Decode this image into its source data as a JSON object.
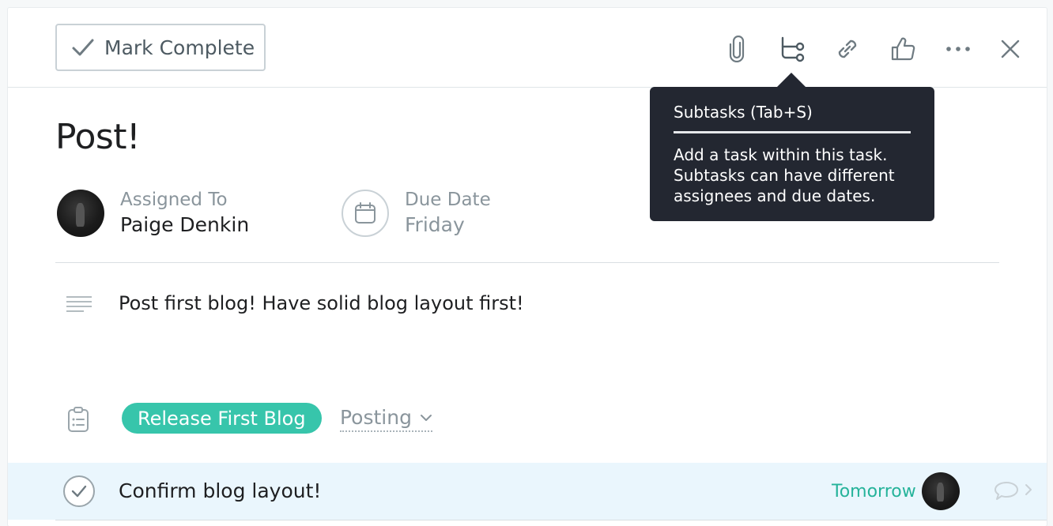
{
  "toolbar": {
    "mark_complete_label": "Mark Complete",
    "icons": [
      "paperclip-icon",
      "subtasks-icon",
      "link-icon",
      "thumbs-up-icon",
      "more-icon",
      "close-icon"
    ]
  },
  "tooltip": {
    "title": "Subtasks (Tab+S)",
    "body": "Add a task within this task. Subtasks can have different assignees and due dates."
  },
  "task": {
    "title": "Post!",
    "assigned_label": "Assigned To",
    "assignee": "Paige Denkin",
    "due_label": "Due Date",
    "due_value": "Friday",
    "description": "Post first blog! Have solid blog layout first!",
    "project": "Release First Blog",
    "section": "Posting"
  },
  "subtask": {
    "name": "Confirm blog layout!",
    "due": "Tomorrow"
  },
  "colors": {
    "project_pill": "#37c5ab",
    "due_green": "#25b39a",
    "tooltip_bg": "#232731",
    "subtask_highlight": "#eaf6fd"
  }
}
